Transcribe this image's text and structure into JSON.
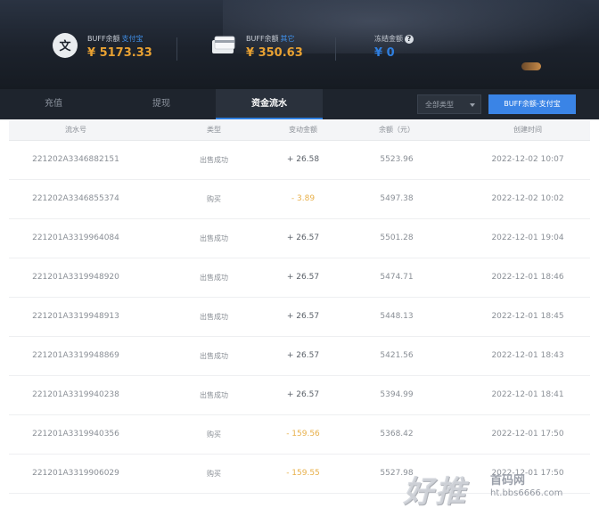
{
  "header": {
    "balances": [
      {
        "icon": "alipay-icon",
        "label": "BUFF余额",
        "tag": "支付宝",
        "value": "¥ 5173.33"
      },
      {
        "icon": "bank-card-icon",
        "label": "BUFF余额",
        "tag": "其它",
        "value": "¥ 350.63"
      },
      {
        "icon": "",
        "label": "冻结金额",
        "tag": "",
        "value": "¥ 0"
      }
    ],
    "help_icon": "?"
  },
  "tabs": [
    {
      "label": "充值",
      "active": false
    },
    {
      "label": "提现",
      "active": false
    },
    {
      "label": "资金流水",
      "active": true
    }
  ],
  "filter_select": {
    "value": "全部类型"
  },
  "action_button": {
    "label": "BUFF余额-支付宝"
  },
  "table": {
    "columns": [
      "流水号",
      "类型",
      "变动金额",
      "余额（元）",
      "创建时间"
    ],
    "rows": [
      {
        "id": "221202A3346882151",
        "type": "出售成功",
        "amount": "+ 26.58",
        "sign": "pos",
        "balance": "5523.96",
        "time": "2022-12-02 10:07"
      },
      {
        "id": "221202A3346855374",
        "type": "购买",
        "amount": "- 3.89",
        "sign": "neg",
        "balance": "5497.38",
        "time": "2022-12-02 10:02"
      },
      {
        "id": "221201A3319964084",
        "type": "出售成功",
        "amount": "+ 26.57",
        "sign": "pos",
        "balance": "5501.28",
        "time": "2022-12-01 19:04"
      },
      {
        "id": "221201A3319948920",
        "type": "出售成功",
        "amount": "+ 26.57",
        "sign": "pos",
        "balance": "5474.71",
        "time": "2022-12-01 18:46"
      },
      {
        "id": "221201A3319948913",
        "type": "出售成功",
        "amount": "+ 26.57",
        "sign": "pos",
        "balance": "5448.13",
        "time": "2022-12-01 18:45"
      },
      {
        "id": "221201A3319948869",
        "type": "出售成功",
        "amount": "+ 26.57",
        "sign": "pos",
        "balance": "5421.56",
        "time": "2022-12-01 18:43"
      },
      {
        "id": "221201A3319940238",
        "type": "出售成功",
        "amount": "+ 26.57",
        "sign": "pos",
        "balance": "5394.99",
        "time": "2022-12-01 18:41"
      },
      {
        "id": "221201A3319940356",
        "type": "购买",
        "amount": "- 159.56",
        "sign": "neg",
        "balance": "5368.42",
        "time": "2022-12-01 17:50"
      },
      {
        "id": "221201A3319906029",
        "type": "购买",
        "amount": "- 159.55",
        "sign": "neg",
        "balance": "5527.98",
        "time": "2022-12-01 17:50"
      }
    ]
  },
  "watermark": {
    "big": "好推",
    "line1": "首码网",
    "line2": "ht.bbs6666.com"
  },
  "colors": {
    "accent": "#3a84e6",
    "amount_gold": "#e8a132",
    "negative": "#e8b04a"
  }
}
